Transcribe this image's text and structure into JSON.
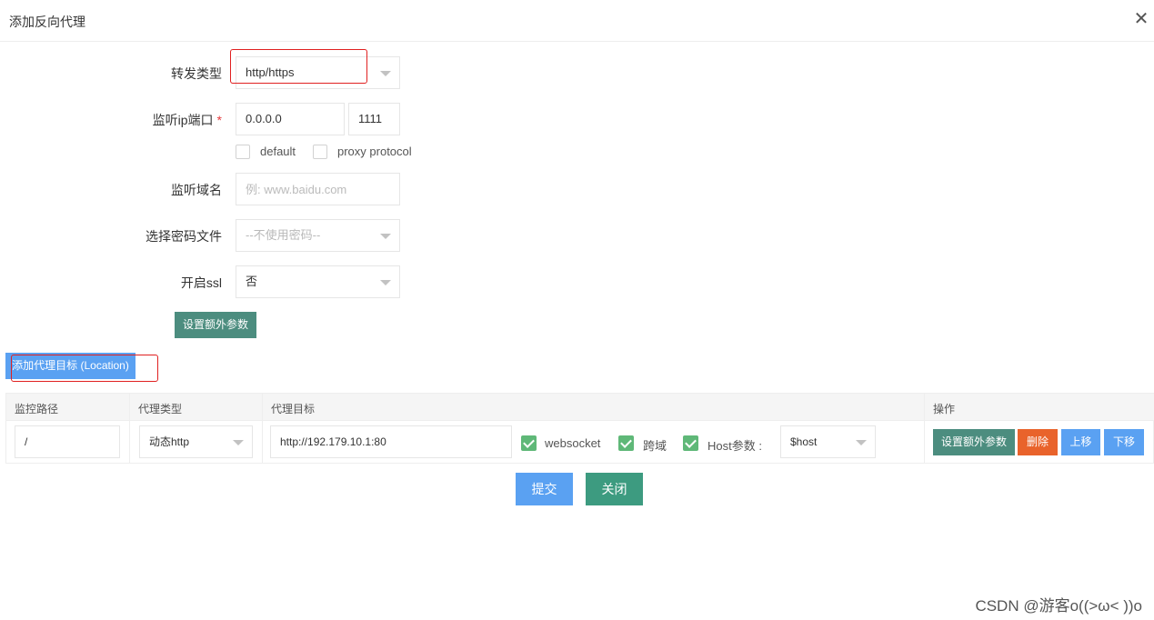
{
  "dialog": {
    "title": "添加反向代理",
    "close": "✕"
  },
  "form": {
    "forward_type": {
      "label": "转发类型",
      "value": "http/https"
    },
    "listen": {
      "label": "监听ip端口",
      "required_mark": "*",
      "ip": "0.0.0.0",
      "port": "1111",
      "default_label": "default",
      "proxy_protocol_label": "proxy protocol"
    },
    "domain": {
      "label": "监听域名",
      "placeholder": "例: www.baidu.com"
    },
    "password_file": {
      "label": "选择密码文件",
      "value": "--不使用密码--"
    },
    "ssl": {
      "label": "开启ssl",
      "value": "否"
    },
    "extra_params_button": "设置额外参数"
  },
  "add_location_button": "添加代理目标 (Location)",
  "table": {
    "headers": [
      "监控路径",
      "代理类型",
      "代理目标",
      "操作"
    ],
    "row": {
      "path": "/",
      "proxy_type": "动态http",
      "target": "http://192.179.10.1:80",
      "websocket_label": "websocket",
      "cross_domain_label": "跨域",
      "host_param_label": "Host参数 :",
      "host_value": "$host",
      "actions": {
        "extra": "设置额外参数",
        "delete": "删除",
        "up": "上移",
        "down": "下移"
      }
    }
  },
  "footer": {
    "submit": "提交",
    "close": "关闭"
  },
  "watermark": "CSDN @游客o((>ω< ))o",
  "colors": {
    "teal": "#4c8d7f",
    "blue": "#5aa1f2",
    "orange": "#e9632b",
    "green": "#3d9b80",
    "check_green": "#5fb878",
    "highlight_red": "#e02020"
  }
}
